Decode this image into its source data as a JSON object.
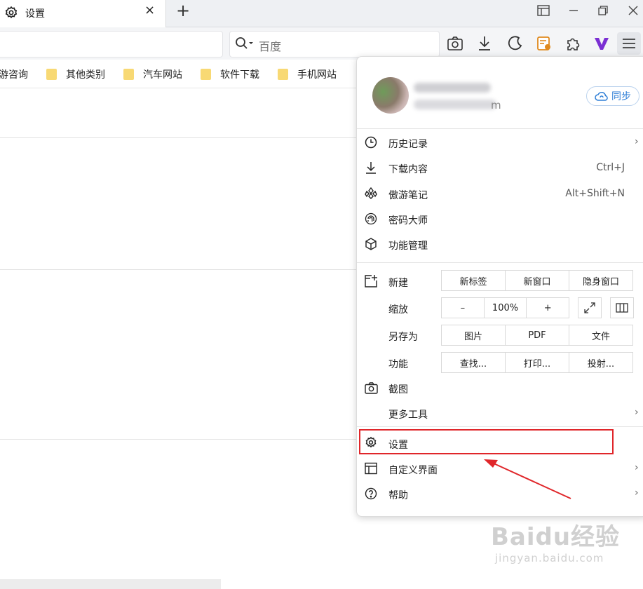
{
  "tab": {
    "title": "设置",
    "close": "×",
    "new_tab": "+"
  },
  "search": {
    "placeholder": "百度"
  },
  "bookmarks": [
    {
      "label": "游咨询"
    },
    {
      "label": "其他类别"
    },
    {
      "label": "汽车网站"
    },
    {
      "label": "软件下载"
    },
    {
      "label": "手机网站"
    }
  ],
  "account": {
    "email_tail": "m",
    "sync_label": "同步"
  },
  "menu": {
    "items_top": [
      {
        "label": "历史记录",
        "icon": "history-icon",
        "shortcut": "",
        "submenu": true
      },
      {
        "label": "下载内容",
        "icon": "download-icon",
        "shortcut": "Ctrl+J",
        "submenu": false
      },
      {
        "label": "傲游笔记",
        "icon": "notes-icon",
        "shortcut": "Alt+Shift+N",
        "submenu": false
      },
      {
        "label": "密码大师",
        "icon": "fingerprint-icon",
        "shortcut": "",
        "submenu": false
      },
      {
        "label": "功能管理",
        "icon": "cube-icon",
        "shortcut": "",
        "submenu": false
      }
    ],
    "new": {
      "label": "新建",
      "buttons": [
        "新标签",
        "新窗口",
        "隐身窗口"
      ]
    },
    "zoom": {
      "label": "缩放",
      "minus": "–",
      "value": "100%",
      "plus": "+"
    },
    "save_as": {
      "label": "另存为",
      "buttons": [
        "图片",
        "PDF",
        "文件"
      ]
    },
    "functions": {
      "label": "功能",
      "buttons": [
        "查找...",
        "打印...",
        "投射..."
      ]
    },
    "screenshot": {
      "label": "截图"
    },
    "more_tools": {
      "label": "更多工具"
    },
    "items_bottom": [
      {
        "label": "设置",
        "icon": "gear-icon",
        "submenu": false
      },
      {
        "label": "自定义界面",
        "icon": "layout-icon",
        "submenu": true
      },
      {
        "label": "帮助",
        "icon": "help-icon",
        "submenu": true
      }
    ]
  },
  "annotation": {
    "highlight_color": "#e0262a"
  },
  "watermark": {
    "logo": "Baidu经验",
    "url": "jingyan.baidu.com"
  }
}
